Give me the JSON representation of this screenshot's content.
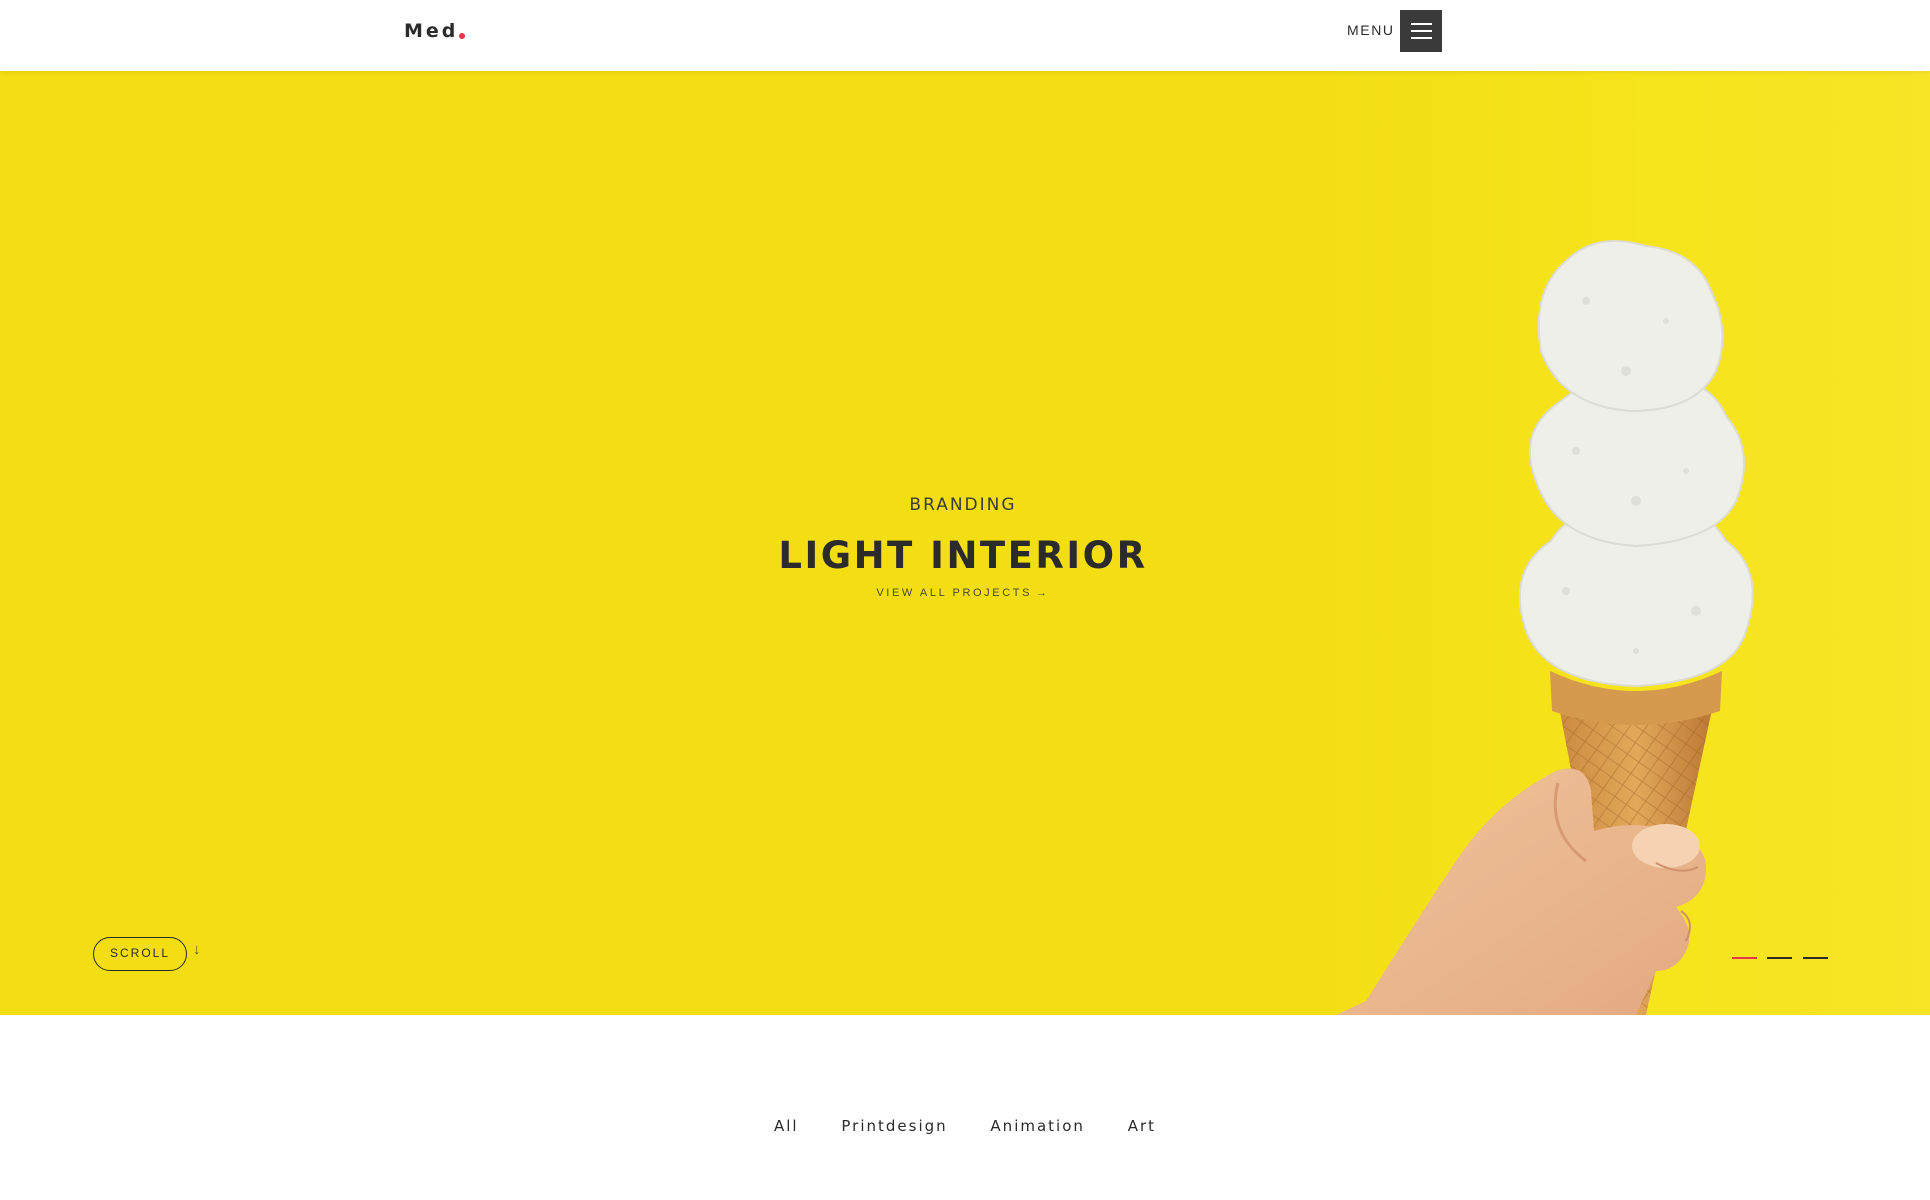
{
  "header": {
    "logo_text": "Med",
    "menu_label": "MENU"
  },
  "hero": {
    "category": "BRANDING",
    "title": "LIGHT INTERIOR",
    "link_label": "VIEW ALL PROJECTS",
    "link_arrow": "→",
    "scroll_label": "SCROLL",
    "scroll_arrow": "↓",
    "slides_count": 3,
    "active_slide": 1
  },
  "filters": [
    "All",
    "Printdesign",
    "Animation",
    "Art"
  ],
  "colors": {
    "hero_background": "#f2de12",
    "accent": "#e8344a",
    "text_dark": "#2b2b2b",
    "menu_button_bg": "#3a3a3a"
  },
  "icons": {
    "menu": "hamburger-icon",
    "scroll": "arrow-down-icon",
    "link": "arrow-right-icon"
  }
}
